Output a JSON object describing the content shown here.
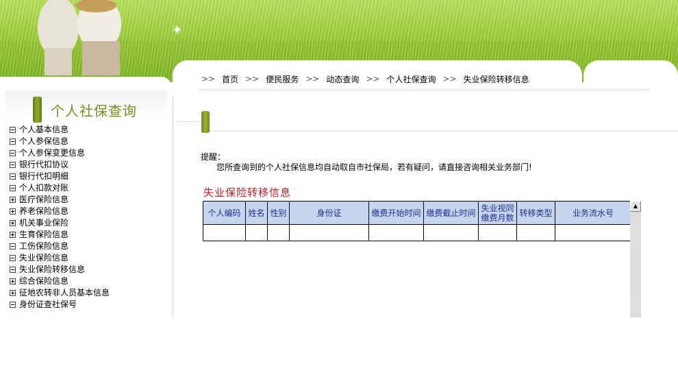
{
  "breadcrumb": {
    "separator": ">>",
    "items": [
      "首页",
      "便民服务",
      "动态查询",
      "个人社保查询",
      "失业保险转移信息"
    ]
  },
  "sidebar": {
    "title": "个人社保查询",
    "items": [
      {
        "label": "个人基本信息",
        "expander": "minus"
      },
      {
        "label": "个人参保信息",
        "expander": "minus"
      },
      {
        "label": "个人参保变更信息",
        "expander": "minus"
      },
      {
        "label": "银行代扣协议",
        "expander": "minus"
      },
      {
        "label": "银行代扣明细",
        "expander": "minus"
      },
      {
        "label": "个人扣款对账",
        "expander": "minus"
      },
      {
        "label": "医疗保险信息",
        "expander": "plus"
      },
      {
        "label": "养老保险信息",
        "expander": "plus"
      },
      {
        "label": "机关事业保险",
        "expander": "plus"
      },
      {
        "label": "生育保险信息",
        "expander": "plus"
      },
      {
        "label": "工伤保险信息",
        "expander": "minus"
      },
      {
        "label": "失业保险信息",
        "expander": "minus"
      },
      {
        "label": "失业保险转移信息",
        "expander": "minus"
      },
      {
        "label": "综合保险信息",
        "expander": "plus"
      },
      {
        "label": "征地农转非人员基本信息",
        "expander": "plus"
      },
      {
        "label": "身份证查社保号",
        "expander": "minus"
      }
    ]
  },
  "notice": {
    "title": "提醒：",
    "text": "您所查询到的个人社保信息均自动取自市社保局，若有疑问，请直接咨询相关业务部门!"
  },
  "section": {
    "title": "失业保险转移信息"
  },
  "table": {
    "headers": [
      "个人编码",
      "姓名",
      "性别",
      "身份证",
      "缴费开始时间",
      "缴费截止时间",
      "失业视同\n缴费月数",
      "转移类型",
      "业务流水号"
    ],
    "rows": [
      [
        "",
        "",
        "",
        "",
        "",
        "",
        "",
        "",
        ""
      ]
    ]
  },
  "icons": {
    "scroll_up": "scroll-up-arrow-icon",
    "expander_plus": "tree-expand-plus-icon",
    "expander_minus": "tree-collapse-minus-icon"
  },
  "colors": {
    "header_bg": "#c5d5ee",
    "header_text": "#1e2f9c",
    "section_title": "#c0232b",
    "sidebar_title": "#7a8d1f",
    "banner_green": "#9ccf3a"
  }
}
